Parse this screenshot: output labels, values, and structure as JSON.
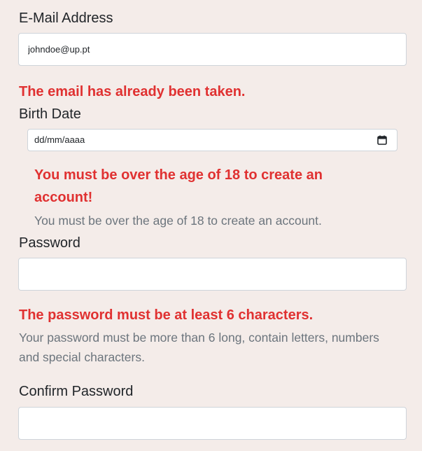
{
  "email": {
    "label": "E-Mail Address",
    "value": "johndoe@up.pt",
    "error": "The email has already been taken."
  },
  "birth_date": {
    "label": "Birth Date",
    "placeholder": "dd/mm/aaaa",
    "error_line1": "You must be over the age of 18 to create an",
    "error_line2": "account!",
    "help": "You must be over the age of 18 to create an account."
  },
  "password": {
    "label": "Password",
    "value": "",
    "error": "The password must be at least 6 characters.",
    "help_line1": "Your password must be more than 6 long, contain letters, numbers",
    "help_line2": "and special characters."
  },
  "confirm_password": {
    "label": "Confirm Password",
    "value": ""
  },
  "colors": {
    "background": "#f4ece9",
    "error": "#e03131",
    "help": "#6c757d"
  }
}
